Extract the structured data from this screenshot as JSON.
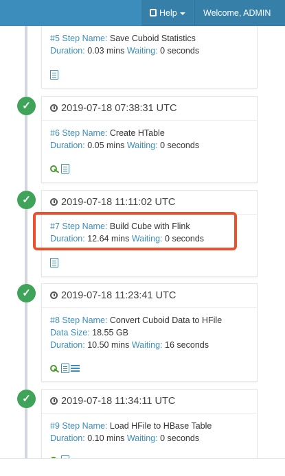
{
  "navbar": {
    "help_label": "Help",
    "welcome_label": "Welcome, ADMIN",
    "color": "#3c8dbc"
  },
  "timeline": {
    "steps": [
      {
        "step_label": "#5 Step Name:",
        "step_name": "Save Cuboid Statistics",
        "duration_label": "Duration:",
        "duration_value": "0.03 mins",
        "waiting_label": "Waiting:",
        "waiting_value": "0 seconds",
        "icons": [
          "document-icon"
        ]
      },
      {
        "status": "success",
        "timestamp": "2019-07-18 07:38:31 UTC",
        "step_label": "#6 Step Name:",
        "step_name": "Create HTable",
        "duration_label": "Duration:",
        "duration_value": "0.05 mins",
        "waiting_label": "Waiting:",
        "waiting_value": "0 seconds",
        "icons": [
          "key-icon",
          "document-icon"
        ]
      },
      {
        "status": "success",
        "timestamp": "2019-07-18 11:11:02 UTC",
        "step_label": "#7 Step Name:",
        "step_name": "Build Cube with Flink",
        "duration_label": "Duration:",
        "duration_value": "12.64 mins",
        "waiting_label": "Waiting:",
        "waiting_value": "0 seconds",
        "icons": [
          "document-icon"
        ],
        "highlight_color": "#e8522f"
      },
      {
        "status": "success",
        "timestamp": "2019-07-18 11:23:41 UTC",
        "step_label": "#8 Step Name:",
        "step_name": "Convert Cuboid Data to HFile",
        "size_label": "Data Size:",
        "size_value": "18.55 GB",
        "duration_label": "Duration:",
        "duration_value": "10.50 mins",
        "waiting_label": "Waiting:",
        "waiting_value": "16 seconds",
        "icons": [
          "key-icon",
          "document-icon",
          "list-icon"
        ]
      },
      {
        "status": "success",
        "timestamp": "2019-07-18 11:34:11 UTC",
        "step_label": "#9 Step Name:",
        "step_name": "Load HFile to HBase Table",
        "duration_label": "Duration:",
        "duration_value": "0.10 mins",
        "waiting_label": "Waiting:",
        "waiting_value": "0 seconds",
        "icons": [
          "key-icon",
          "document-icon"
        ]
      }
    ]
  }
}
